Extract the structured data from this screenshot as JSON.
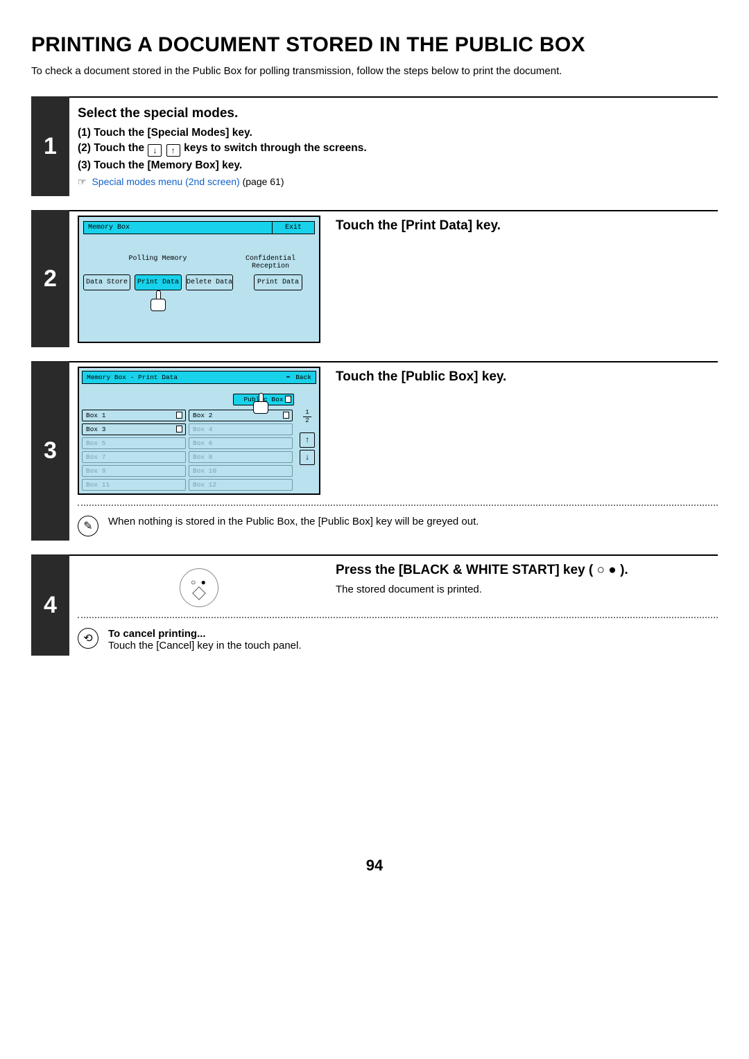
{
  "title": "PRINTING A DOCUMENT STORED IN THE PUBLIC BOX",
  "intro": "To check a document stored in the Public Box for polling transmission, follow the steps below to print the document.",
  "step1": {
    "num": "1",
    "heading": "Select the special modes.",
    "sub1": "(1)  Touch the [Special Modes] key.",
    "sub2a": "(2)  Touch the ",
    "sub2b": " keys to switch through the screens.",
    "sub3": "(3)  Touch the [Memory Box] key.",
    "link_icon": "☞",
    "link_text": "Special modes menu (2nd screen)",
    "link_page": " (page 61)"
  },
  "step2": {
    "num": "2",
    "heading": "Touch the [Print Data] key.",
    "panel": {
      "title": "Memory Box",
      "exit": "Exit",
      "lab1": "Polling Memory",
      "lab2": "Confidential\nReception",
      "btn1": "Data Store",
      "btn2": "Print Data",
      "btn3": "Delete Data",
      "btn4": "Print Data"
    }
  },
  "step3": {
    "num": "3",
    "heading": "Touch the [Public Box] key.",
    "panel": {
      "title": "Memory Box - Print Data",
      "back": "Back",
      "public": "Public Box",
      "boxes": [
        {
          "label": "Box 1",
          "doc": true,
          "enabled": true
        },
        {
          "label": "Box 2",
          "doc": true,
          "enabled": true
        },
        {
          "label": "Box 3",
          "doc": true,
          "enabled": true
        },
        {
          "label": "Box 4",
          "doc": false,
          "enabled": false
        },
        {
          "label": "Box 5",
          "doc": false,
          "enabled": false
        },
        {
          "label": "Box 6",
          "doc": false,
          "enabled": false
        },
        {
          "label": "Box 7",
          "doc": false,
          "enabled": false
        },
        {
          "label": "Box 8",
          "doc": false,
          "enabled": false
        },
        {
          "label": "Box 9",
          "doc": false,
          "enabled": false
        },
        {
          "label": "Box 10",
          "doc": false,
          "enabled": false
        },
        {
          "label": "Box 11",
          "doc": false,
          "enabled": false
        },
        {
          "label": "Box 12",
          "doc": false,
          "enabled": false
        }
      ],
      "page_top": "1",
      "page_bottom": "2"
    },
    "note": "When nothing is stored in the Public Box, the [Public Box] key will be greyed out."
  },
  "step4": {
    "num": "4",
    "heading_a": "Press the [BLACK & WHITE START] key (",
    "heading_b": ").",
    "body": "The stored document is printed.",
    "cancel_head": "To cancel printing...",
    "cancel_body": "Touch the [Cancel] key in the touch panel."
  },
  "page_number": "94"
}
